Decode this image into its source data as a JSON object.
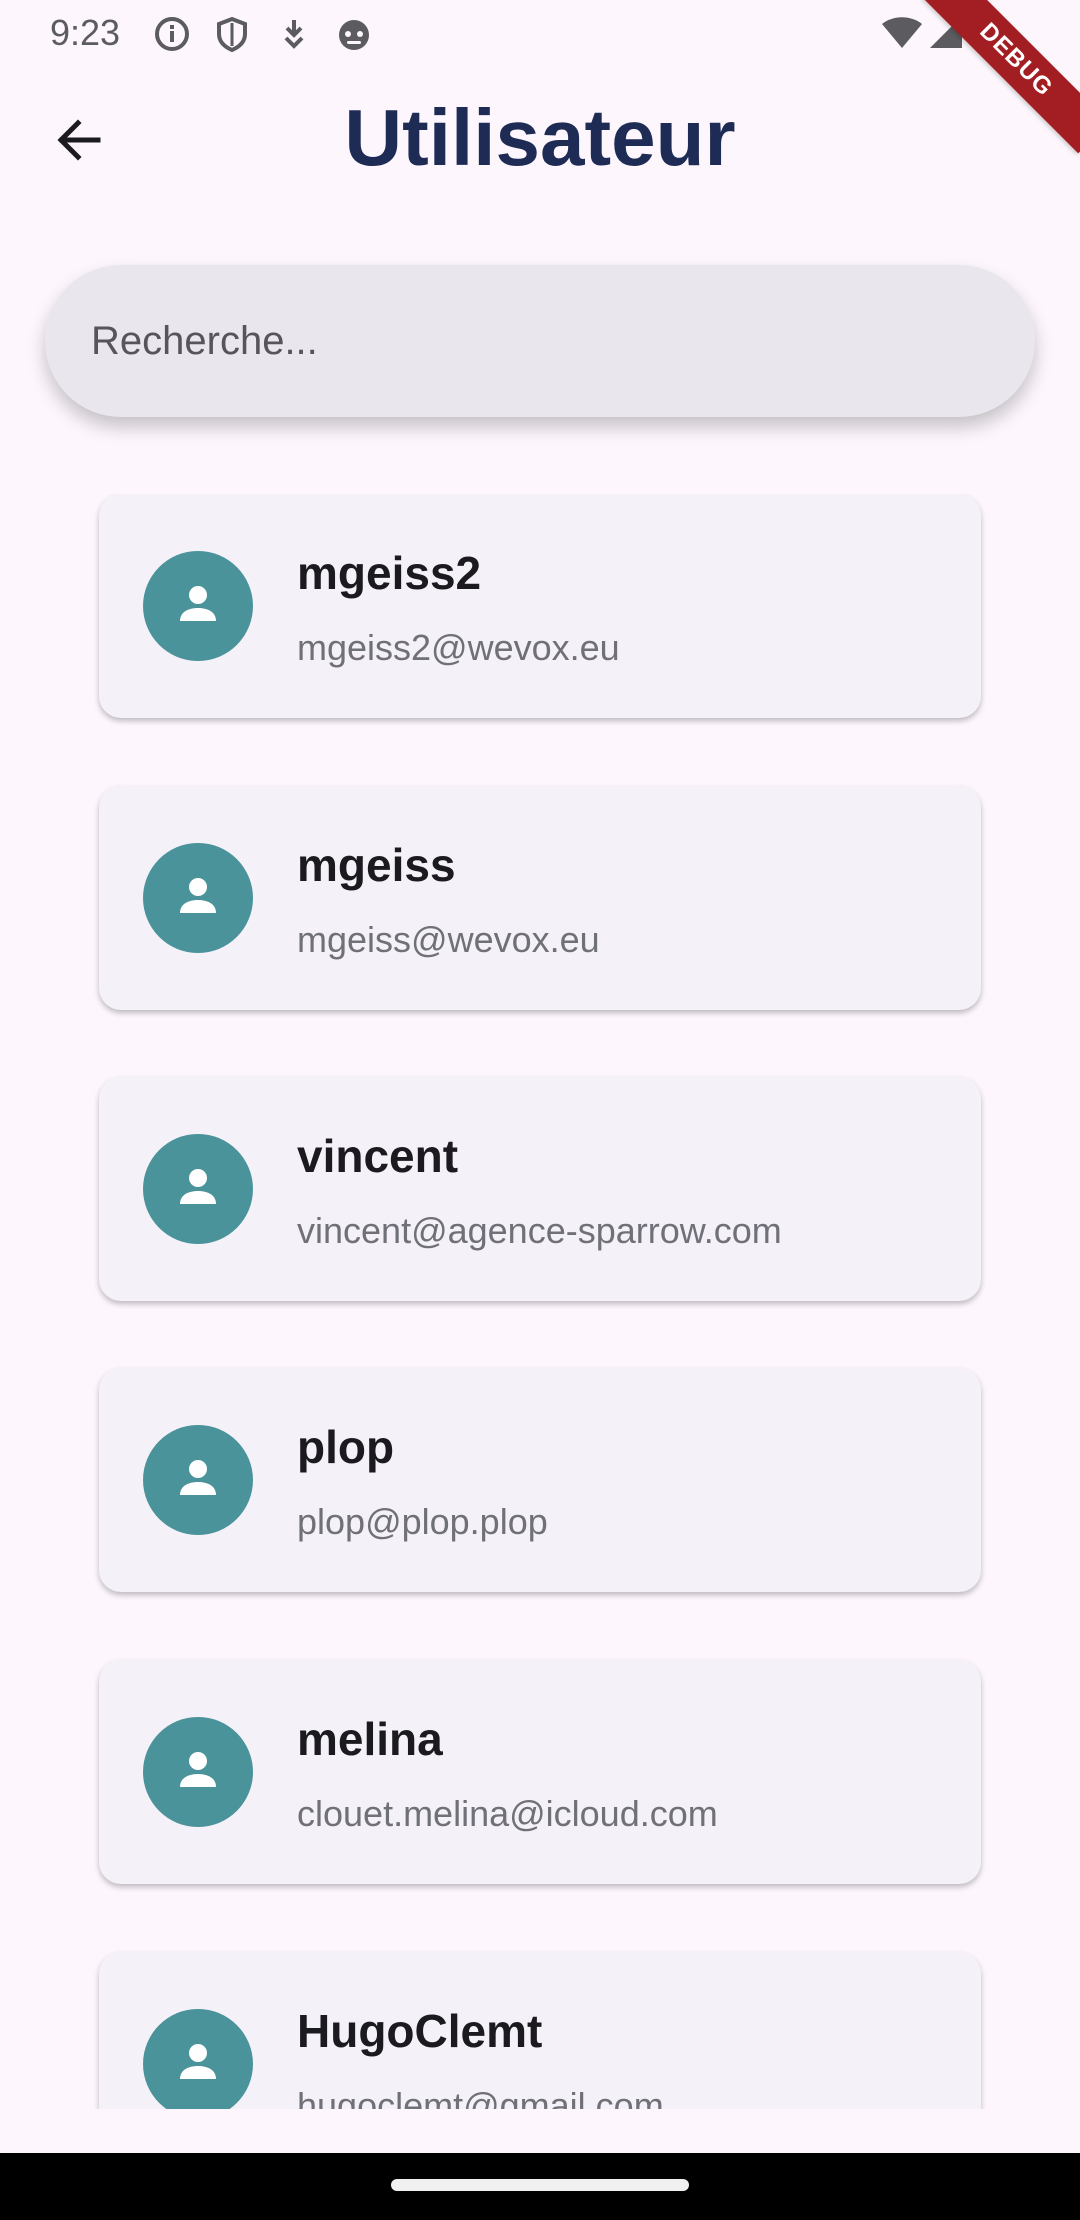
{
  "status_bar": {
    "time": "9:23",
    "left_icons": [
      "info-icon",
      "shield-icon",
      "download-icon",
      "android-face-icon"
    ],
    "right_icons": [
      "wifi-icon",
      "cell-signal-icon"
    ]
  },
  "debug_banner": "DEBUG",
  "header": {
    "back_icon": "arrow-left-icon",
    "title": "Utilisateur"
  },
  "search": {
    "placeholder": "Recherche...",
    "value": ""
  },
  "users": [
    {
      "name": "mgeiss2",
      "email": "mgeiss2@wevox.eu",
      "icon": "person-icon"
    },
    {
      "name": "mgeiss",
      "email": "mgeiss@wevox.eu",
      "icon": "person-icon"
    },
    {
      "name": "vincent",
      "email": "vincent@agence-sparrow.com",
      "icon": "person-icon"
    },
    {
      "name": "plop",
      "email": "plop@plop.plop",
      "icon": "person-icon"
    },
    {
      "name": "melina",
      "email": "clouet.melina@icloud.com",
      "icon": "person-icon"
    },
    {
      "name": "HugoClemt",
      "email": "hugoclemt@gmail.com",
      "icon": "person-icon"
    }
  ],
  "colors": {
    "background": "#fdf7fd",
    "title": "#1e2b55",
    "avatar": "#4a939b",
    "card": "#f5f1f8",
    "search": "#e9e6ee",
    "debug": "#a31e22"
  }
}
